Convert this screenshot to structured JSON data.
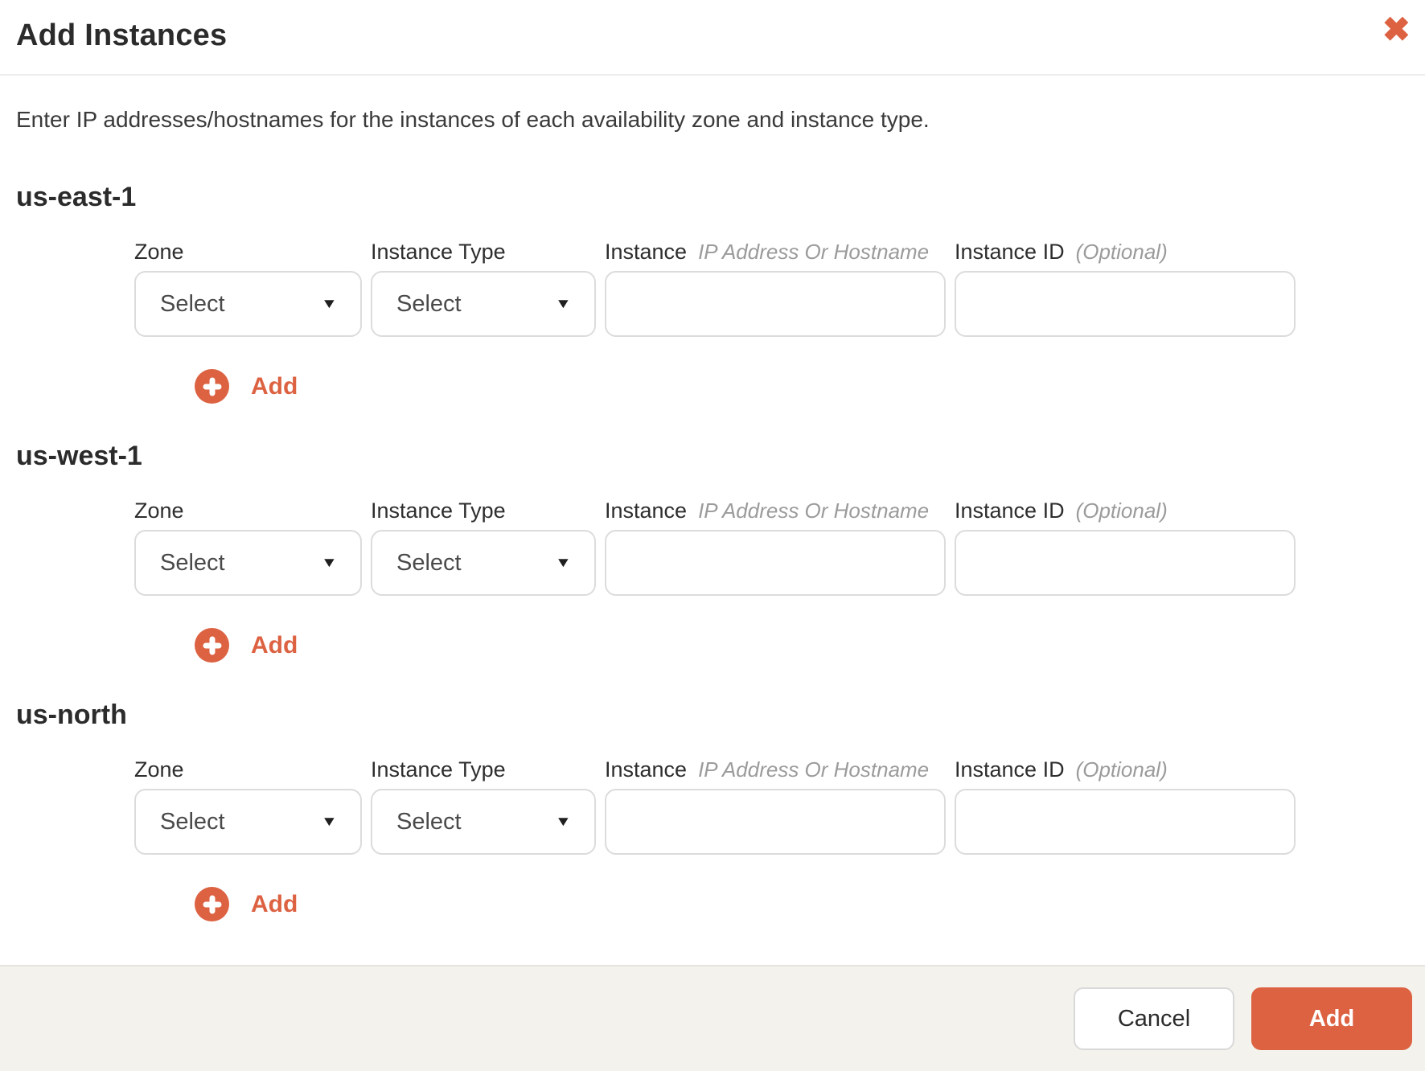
{
  "header": {
    "title": "Add Instances",
    "close_icon": "✖"
  },
  "description": "Enter IP addresses/hostnames for the instances of each availability zone and instance type.",
  "form": {
    "labels": {
      "zone": "Zone",
      "instance_type": "Instance Type",
      "instance": "Instance",
      "instance_hint": "IP Address Or Hostname",
      "instance_id": "Instance ID",
      "instance_id_hint": "(Optional)"
    },
    "select_caret": "▼",
    "add_row_label": "Add",
    "sections": [
      {
        "name": "us-east-1",
        "zone_value": "Select",
        "instance_type_value": "Select",
        "instance_value": "",
        "instance_id_value": ""
      },
      {
        "name": "us-west-1",
        "zone_value": "Select",
        "instance_type_value": "Select",
        "instance_value": "",
        "instance_id_value": ""
      },
      {
        "name": "us-north",
        "zone_value": "Select",
        "instance_type_value": "Select",
        "instance_value": "",
        "instance_id_value": ""
      }
    ]
  },
  "footer": {
    "cancel_label": "Cancel",
    "add_label": "Add"
  },
  "colors": {
    "accent": "#dc6242",
    "footer_background": "#f3f2ed"
  }
}
